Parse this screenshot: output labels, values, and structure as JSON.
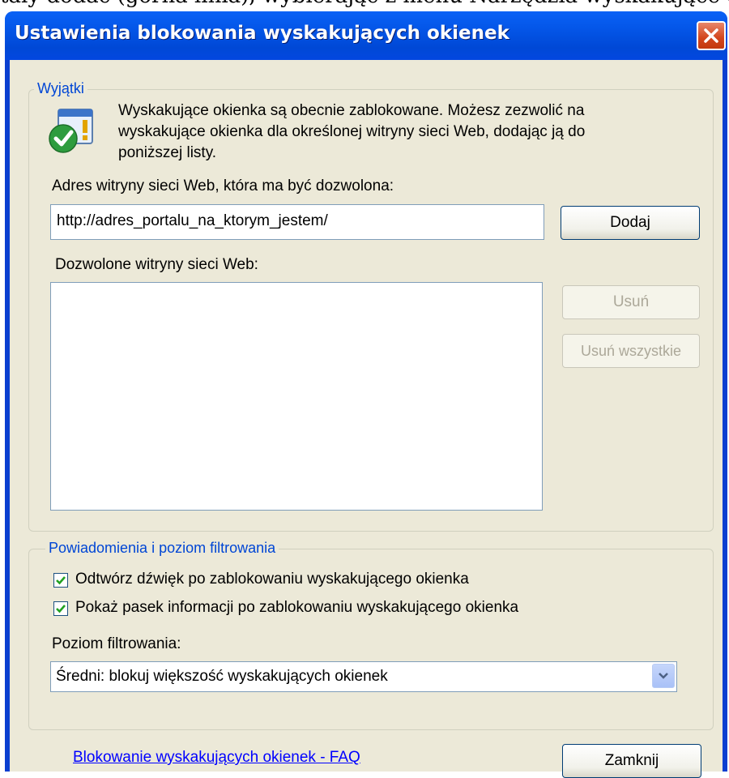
{
  "background_text": "tały dodać (górna linia), wybierając z menu Narzędzia wyskakujące okienka",
  "window": {
    "title": "Ustawienia blokowania wyskakujących okienek"
  },
  "exceptions": {
    "legend": "Wyjątki",
    "info": [
      "Wyskakujące okienka są obecnie zablokowane. Możesz zezwolić na",
      "wyskakujące okienka dla określonej witryny sieci Web, dodając ją do",
      "poniższej listy."
    ],
    "address_label": "Adres witryny sieci Web, która ma być dozwolona:",
    "address_value": "http://adres_portalu_na_ktorym_jestem/",
    "add_button": "Dodaj",
    "allowed_label": "Dozwolone witryny sieci Web:",
    "allowed_sites": [],
    "remove_button": "Usuń",
    "remove_all_button": "Usuń wszystkie"
  },
  "notifications": {
    "legend": "Powiadomienia i poziom filtrowania",
    "play_sound": {
      "label": "Odtwórz dźwięk po zablokowaniu wyskakującego okienka",
      "checked": true
    },
    "show_infobar": {
      "label": "Pokaż pasek informacji po zablokowaniu wyskakującego okienka",
      "checked": true
    },
    "filter_label": "Poziom filtrowania:",
    "filter_value": "Średni: blokuj większość wyskakujących okienek"
  },
  "footer": {
    "faq_link": "Blokowanie wyskakujących okienek - FAQ",
    "close_button": "Zamknij"
  },
  "colors": {
    "title_bar": "#0454e6",
    "dialog_bg": "#ece9d8",
    "legend_text": "#0046d5",
    "link": "#0000ff",
    "close_button": "#d2451c"
  }
}
